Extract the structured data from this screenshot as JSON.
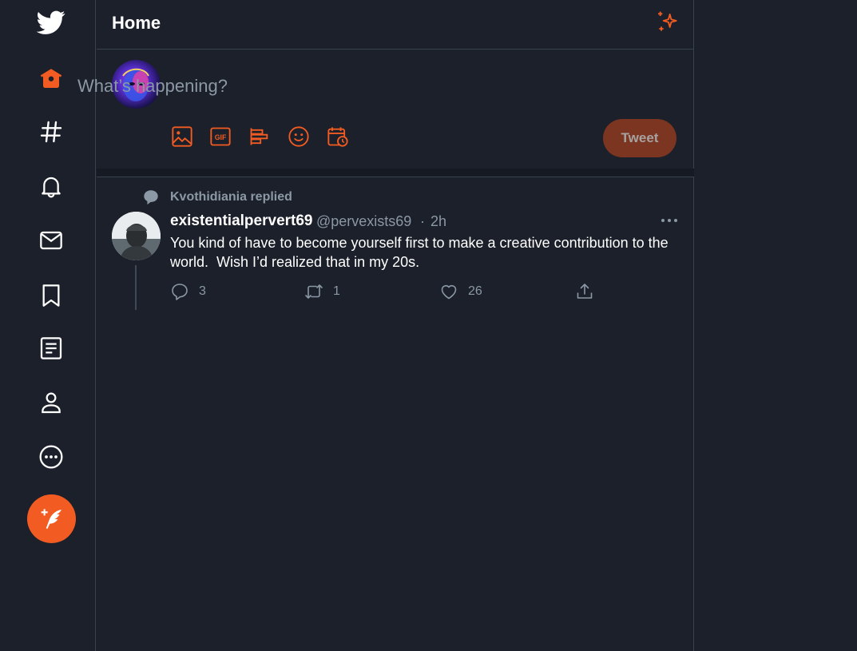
{
  "sidebar": {
    "items": [
      {
        "name": "twitter-logo"
      },
      {
        "name": "home",
        "active": true
      },
      {
        "name": "explore"
      },
      {
        "name": "notifications"
      },
      {
        "name": "messages"
      },
      {
        "name": "bookmarks"
      },
      {
        "name": "lists"
      },
      {
        "name": "profile"
      },
      {
        "name": "more"
      }
    ],
    "compose_icon": "feather-plus-icon"
  },
  "header": {
    "title": "Home",
    "action_icon": "sparkle-icon"
  },
  "composer": {
    "placeholder": "What’s happening?",
    "tools": [
      "image-icon",
      "gif-icon",
      "poll-icon",
      "emoji-icon",
      "schedule-icon"
    ],
    "tweet_label": "Tweet"
  },
  "timeline": {
    "tweets": [
      {
        "social_context": "Kvothidiania replied",
        "display_name": "existentialpervert69",
        "handle": "@pervexists69",
        "separator": "·",
        "time": "2h",
        "text": "You kind of have to become yourself first to make a creative contribution to the world.  Wish I’d realized that in my 20s.",
        "reply_count": "3",
        "retweet_count": "1",
        "like_count": "26"
      }
    ]
  },
  "colors": {
    "accent": "#f25c22",
    "background": "#1b202a",
    "border": "#38444d",
    "secondary_text": "#8b98a5",
    "tweet_button_bg": "#7b3521"
  }
}
